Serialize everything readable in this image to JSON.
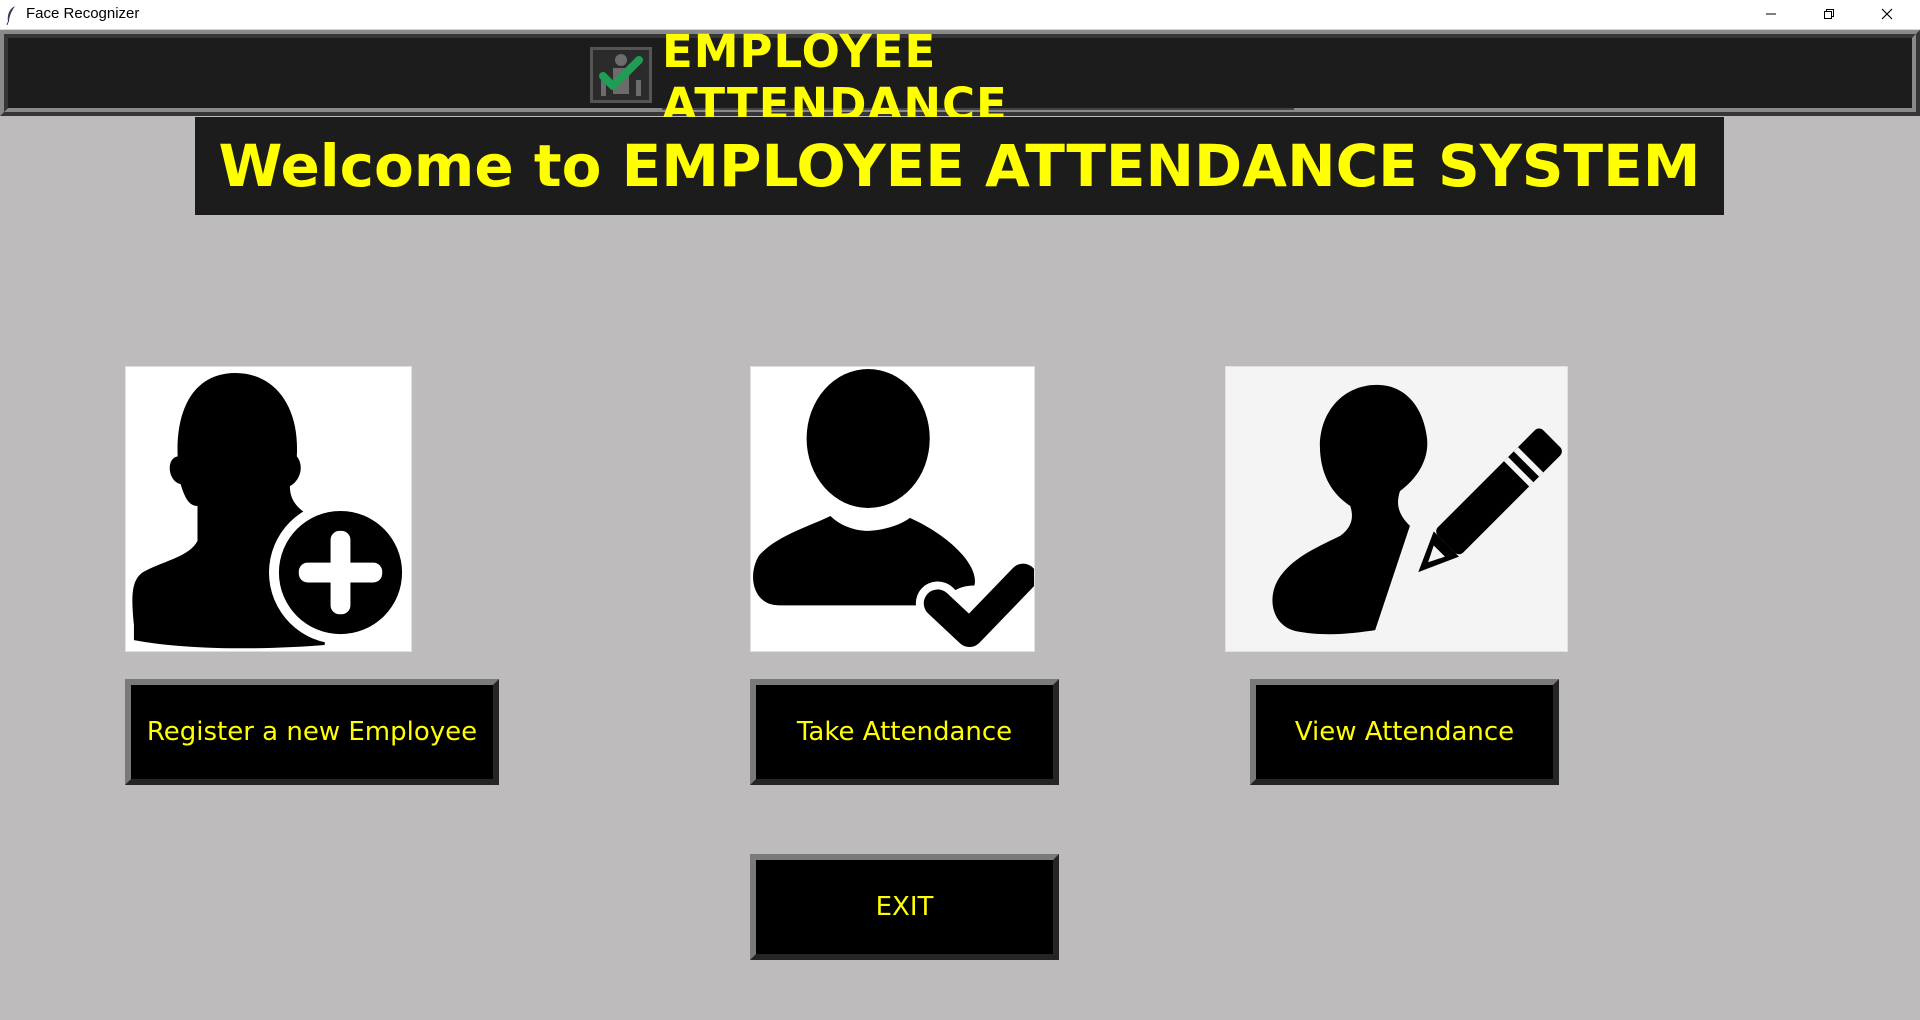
{
  "window": {
    "title": "Face Recognizer",
    "icons": {
      "app": "feather-icon",
      "minimize": "minimize-icon",
      "restore": "restore-icon",
      "close": "close-icon"
    }
  },
  "header": {
    "title": "EMPLOYEE ATTENDANCE",
    "logo_icon": "attendance-check-icon"
  },
  "welcome": {
    "text": "Welcome to EMPLOYEE ATTENDANCE SYSTEM"
  },
  "actions": {
    "register": {
      "label": "Register a new Employee",
      "icon": "add-user-icon"
    },
    "take": {
      "label": "Take Attendance",
      "icon": "user-check-icon"
    },
    "view": {
      "label": "View Attendance",
      "icon": "user-edit-icon"
    },
    "exit": {
      "label": "EXIT"
    }
  },
  "colors": {
    "background": "#bdbbbc",
    "banner": "#1c1c1c",
    "accent_text": "#ffff00",
    "button": "#000000",
    "check_green": "#1f9d55"
  }
}
